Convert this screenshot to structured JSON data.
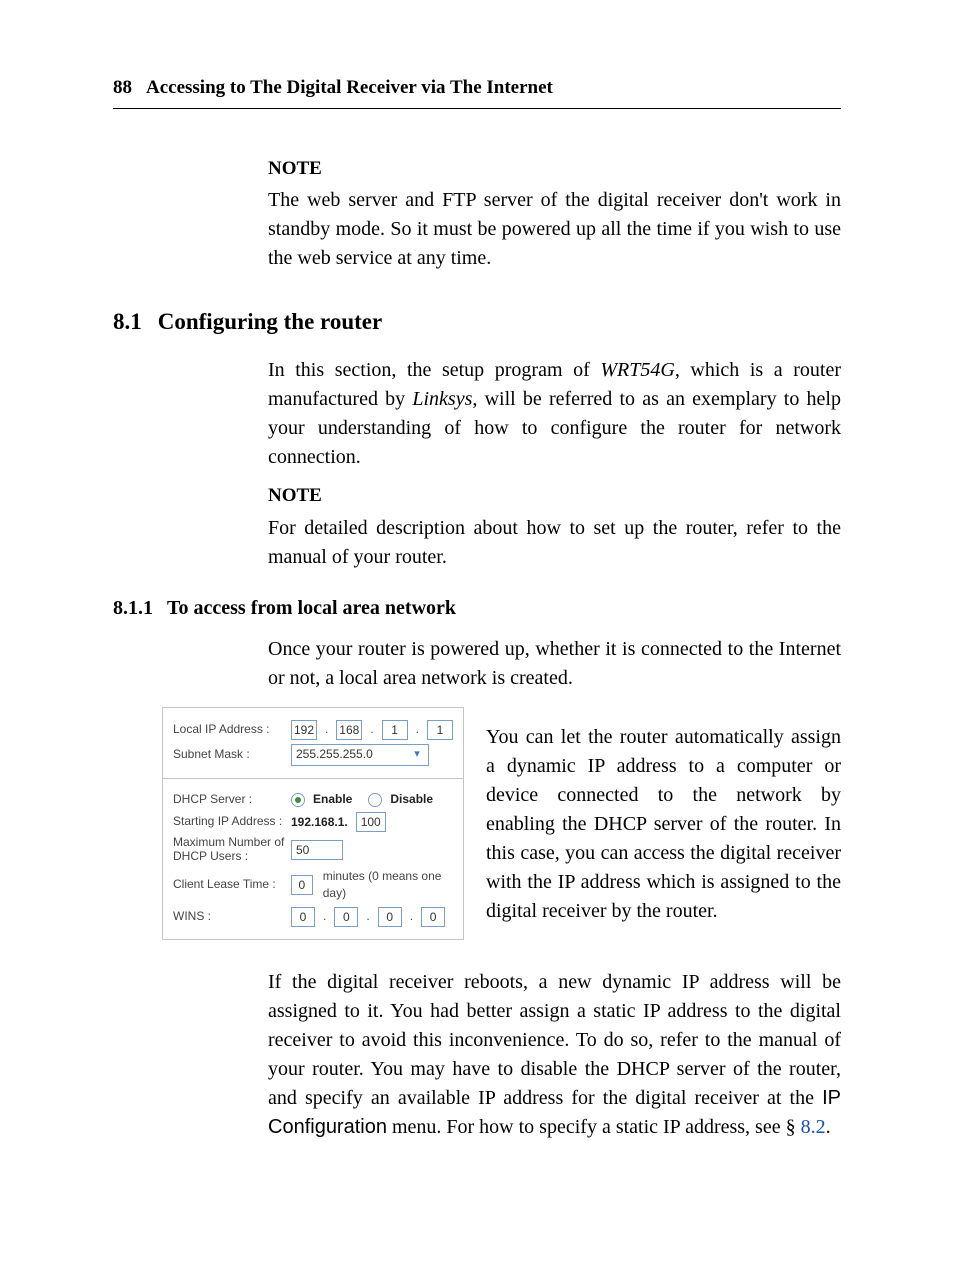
{
  "header": {
    "page_number": "88",
    "title": "Accessing to The Digital Receiver via The Internet"
  },
  "note1": {
    "heading": "NOTE",
    "body": "The web server and FTP server of the digital receiver don't work in standby mode. So it must be powered up all the time if you wish to use the web service at any time."
  },
  "section": {
    "number": "8.1",
    "title": "Configuring the router",
    "intro_pre": "In this section, the setup program of ",
    "intro_em1": "WRT54G",
    "intro_mid": ", which is a router manufactured by ",
    "intro_em2": "Linksys",
    "intro_post": ", will be referred to as an exemplary to help your understanding of how to configure the router for network connection."
  },
  "note2": {
    "heading": "NOTE",
    "body": "For detailed description about how to set up the router, refer to the manual of your router."
  },
  "subsection": {
    "number": "8.1.1",
    "title": "To access from local area network",
    "lead": "Once your router is powered up, whether it is connected to the Internet or not, a local area network is created.",
    "wrap": "You can let the router automatically assign a dynamic IP address to a computer or device connected to the network by enabling the DHCP server of the router. In this case, you can access the digital receiver with the IP address which is assigned to the digital receiver by the router.",
    "after_pre": "If the digital receiver reboots, a new dynamic IP address will be assigned to it. You had better assign a static IP address to the digital receiver to avoid this inconvenience. To do so, refer to the manual of your router. You may have to disable the DHCP server of the router, and specify an available IP address for the digital receiver at the ",
    "after_menu": "IP Configuration",
    "after_mid": " menu.  For how to specify a static IP address, see § ",
    "after_xref": "8.2",
    "after_end": "."
  },
  "figure": {
    "labels": {
      "local_ip": "Local IP Address :",
      "subnet": "Subnet Mask :",
      "dhcp_server": "DHCP Server :",
      "starting_ip": "Starting IP Address :",
      "max_users": "Maximum Number of DHCP Users :",
      "lease": "Client Lease Time :",
      "wins": "WINS :"
    },
    "local_ip_octets": [
      "192",
      "168",
      "1",
      "1"
    ],
    "subnet_value": "255.255.255.0",
    "dhcp_enable": "Enable",
    "dhcp_disable": "Disable",
    "starting_ip_prefix": "192.168.1.",
    "starting_ip_value": "100",
    "max_users_value": "50",
    "lease_value": "0",
    "lease_suffix": "minutes (0 means one day)",
    "wins_octets": [
      "0",
      "0",
      "0",
      "0"
    ]
  }
}
